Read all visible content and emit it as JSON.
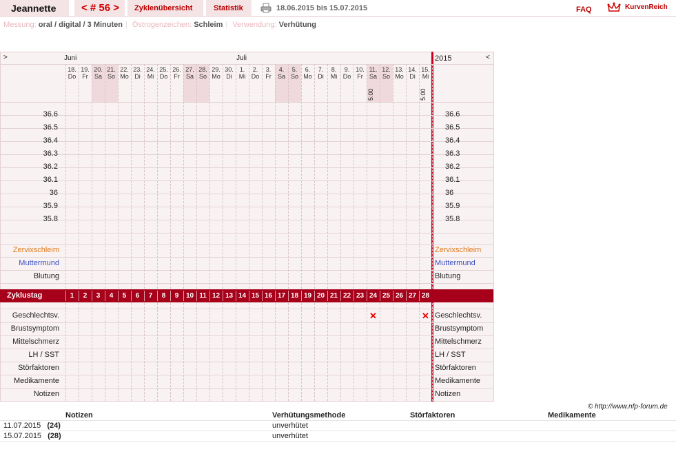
{
  "header": {
    "name": "Jeannette",
    "cycle_label": "< # 56 >",
    "tab_overview": "Zyklenübersicht",
    "tab_stats": "Statistik",
    "date_range": "18.06.2015 bis 15.07.2015",
    "faq": "FAQ",
    "brand": "KurvenReich"
  },
  "info": {
    "messung_label": "Messung:",
    "messung_value": "oral / digital / 3 Minuten",
    "oestro_label": "Östrogenzeichen:",
    "oestro_value": "Schleim",
    "verwendung_label": "Verwendung:",
    "verwendung_value": "Verhütung"
  },
  "chart": {
    "nav_left": ">",
    "nav_right": "<",
    "year": "2015",
    "month_labels": [
      "Juni",
      "Juli"
    ],
    "days": [
      {
        "d": "18.",
        "n": "Do"
      },
      {
        "d": "19.",
        "n": "Fr"
      },
      {
        "d": "20.",
        "n": "Sa"
      },
      {
        "d": "21.",
        "n": "So"
      },
      {
        "d": "22.",
        "n": "Mo"
      },
      {
        "d": "23.",
        "n": "Di"
      },
      {
        "d": "24.",
        "n": "Mi"
      },
      {
        "d": "25.",
        "n": "Do"
      },
      {
        "d": "26.",
        "n": "Fr"
      },
      {
        "d": "27.",
        "n": "Sa"
      },
      {
        "d": "28.",
        "n": "So"
      },
      {
        "d": "29.",
        "n": "Mo"
      },
      {
        "d": "30.",
        "n": "Di"
      },
      {
        "d": "1.",
        "n": "Mi"
      },
      {
        "d": "2.",
        "n": "Do"
      },
      {
        "d": "3.",
        "n": "Fr"
      },
      {
        "d": "4.",
        "n": "Sa"
      },
      {
        "d": "5.",
        "n": "So"
      },
      {
        "d": "6.",
        "n": "Mo"
      },
      {
        "d": "7.",
        "n": "Di"
      },
      {
        "d": "8.",
        "n": "Mi"
      },
      {
        "d": "9.",
        "n": "Do"
      },
      {
        "d": "10.",
        "n": "Fr"
      },
      {
        "d": "11.",
        "n": "Sa"
      },
      {
        "d": "12.",
        "n": "So"
      },
      {
        "d": "13.",
        "n": "Mo"
      },
      {
        "d": "14.",
        "n": "Di"
      },
      {
        "d": "15.",
        "n": "Mi"
      }
    ],
    "weekend_indices": [
      2,
      3,
      9,
      10,
      16,
      17,
      23,
      24
    ],
    "time_labels": [
      {
        "index": 23,
        "text": "5:00"
      },
      {
        "index": 27,
        "text": "5:00"
      }
    ],
    "temps": [
      "36.6",
      "36.5",
      "36.4",
      "36.3",
      "36.2",
      "36.1",
      "36",
      "35.9",
      "35.8"
    ],
    "row_zervix": "Zervixschleim",
    "row_mutter": "Muttermund",
    "row_blutung": "Blutung",
    "zyklustag_label": "Zyklustag",
    "zyklustage": [
      "1",
      "2",
      "3",
      "4",
      "5",
      "6",
      "7",
      "8",
      "9",
      "10",
      "11",
      "12",
      "13",
      "14",
      "15",
      "16",
      "17",
      "18",
      "19",
      "20",
      "21",
      "22",
      "23",
      "24",
      "25",
      "26",
      "27",
      "28"
    ],
    "bottom_rows": [
      "Geschlechtsv.",
      "Brustsymptom",
      "Mittelschmerz",
      "LH / SST",
      "Störfaktoren",
      "Medikamente",
      "Notizen"
    ],
    "sex_marks": [
      23,
      27
    ],
    "mark_symbol": "✕",
    "colors": {
      "accent": "#a6001a",
      "zervix": "#e07a1a",
      "mutter": "#3a4fc0"
    }
  },
  "credit": "© http://www.nfp-forum.de",
  "notes_table": {
    "headers": [
      "Notizen",
      "Verhütungsmethode",
      "Störfaktoren",
      "Medikamente"
    ],
    "rows": [
      {
        "date": "11.07.2015",
        "day": "(24)",
        "method": "unverhütet"
      },
      {
        "date": "15.07.2015",
        "day": "(28)",
        "method": "unverhütet"
      }
    ]
  }
}
